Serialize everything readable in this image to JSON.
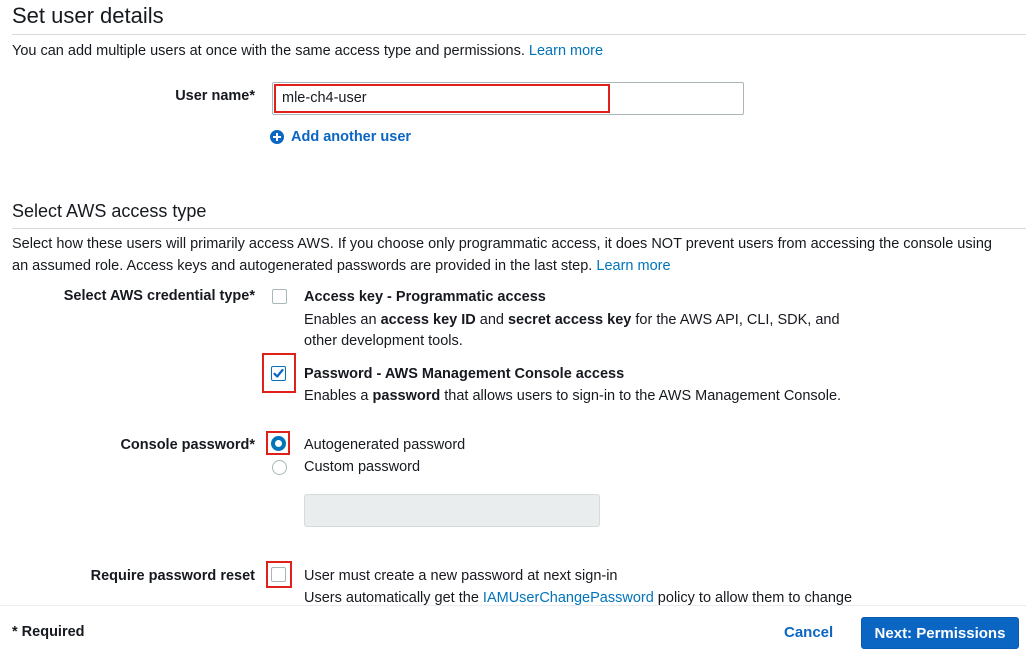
{
  "user_details": {
    "title": "Set user details",
    "intro_text": "You can add multiple users at once with the same access type and permissions.",
    "intro_link": "Learn more",
    "username_label": "User name*",
    "username_value": "mle-ch4-user",
    "add_user_label": "Add another user"
  },
  "access_type": {
    "title": "Select AWS access type",
    "desc_line1": "Select how these users will primarily access AWS. If you choose only programmatic access, it does NOT prevent users from accessing the console using",
    "desc_line2": "an assumed role. Access keys and autogenerated passwords are provided in the last step.",
    "desc_link": "Learn more",
    "credential_label": "Select AWS credential type*",
    "programmatic": {
      "title": "Access key - Programmatic access",
      "desc_pre": "Enables an ",
      "desc_b1": "access key ID",
      "desc_mid": " and ",
      "desc_b2": "secret access key",
      "desc_post": " for the AWS API, CLI, SDK, and",
      "desc_line2": "other development tools.",
      "checked": false
    },
    "console": {
      "title": "Password - AWS Management Console access",
      "desc_pre": "Enables a ",
      "desc_b": "password",
      "desc_post": " that allows users to sign-in to the AWS Management Console.",
      "checked": true
    }
  },
  "console_password": {
    "label": "Console password*",
    "option_auto": "Autogenerated password",
    "option_custom": "Custom password",
    "selected": "Autogenerated password"
  },
  "password_reset": {
    "label": "Require password reset",
    "option": "User must create a new password at next sign-in",
    "desc_pre": "Users automatically get the ",
    "desc_link": "IAMUserChangePassword",
    "desc_post": " policy to allow them to change",
    "checked": false
  },
  "footer": {
    "required_note": "* Required",
    "cancel_label": "Cancel",
    "next_label": "Next: Permissions"
  },
  "colors": {
    "link": "#0073bb",
    "primary_button": "#0b65c2",
    "highlight": "#e0201b"
  }
}
